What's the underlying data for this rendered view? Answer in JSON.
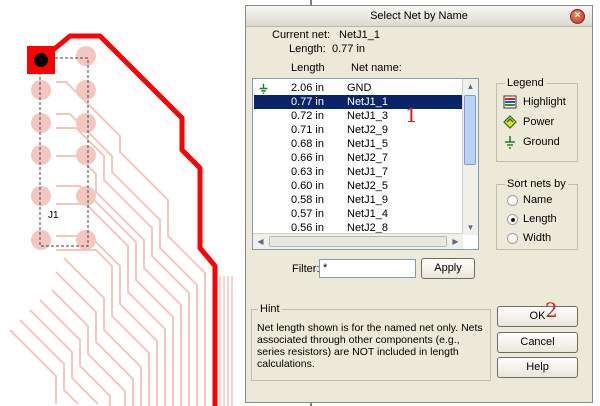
{
  "pcb": {
    "component_label": "J1",
    "trace_color": "#ff0000",
    "pad_color": "#f4c6c0"
  },
  "dialog": {
    "title": "Select Net by Name",
    "close_icon": "close-icon",
    "current_net_label": "Current net:",
    "current_net_value": "NetJ1_1",
    "length_label": "Length:",
    "length_value": "0.77 in",
    "columns": {
      "length": "Length",
      "net_name": "Net name:"
    },
    "rows": [
      {
        "length": "2.06 in",
        "name": "GND",
        "icon": "ground-icon",
        "selected": false
      },
      {
        "length": "0.77 in",
        "name": "NetJ1_1",
        "selected": true
      },
      {
        "length": "0.72 in",
        "name": "NetJ1_3",
        "selected": false
      },
      {
        "length": "0.71 in",
        "name": "NetJ2_9",
        "selected": false
      },
      {
        "length": "0.68 in",
        "name": "NetJ1_5",
        "selected": false
      },
      {
        "length": "0.66 in",
        "name": "NetJ2_7",
        "selected": false
      },
      {
        "length": "0.63 in",
        "name": "NetJ1_7",
        "selected": false
      },
      {
        "length": "0.60 in",
        "name": "NetJ2_5",
        "selected": false
      },
      {
        "length": "0.58 in",
        "name": "NetJ1_9",
        "selected": false
      },
      {
        "length": "0.57 in",
        "name": "NetJ1_4",
        "selected": false
      },
      {
        "length": "0.56 in",
        "name": "NetJ2_8",
        "selected": false
      }
    ],
    "legend": {
      "title": "Legend",
      "items": [
        {
          "label": "Highlight",
          "icon": "highlight-icon"
        },
        {
          "label": "Power",
          "icon": "power-icon"
        },
        {
          "label": "Ground",
          "icon": "ground-icon"
        }
      ]
    },
    "sort": {
      "title": "Sort nets by",
      "options": [
        {
          "label": "Name",
          "checked": false
        },
        {
          "label": "Length",
          "checked": true
        },
        {
          "label": "Width",
          "checked": false
        }
      ]
    },
    "filter": {
      "label": "Filter:",
      "value": "*"
    },
    "apply_label": "Apply",
    "hint": {
      "title": "Hint",
      "text": "Net length shown is for the named net only. Nets associated through other components (e.g., series resistors) are NOT included in length calculations."
    },
    "ok_label": "OK",
    "cancel_label": "Cancel",
    "help_label": "Help"
  },
  "annotations": {
    "one": "1",
    "two": "2",
    "color": "#d42020"
  }
}
